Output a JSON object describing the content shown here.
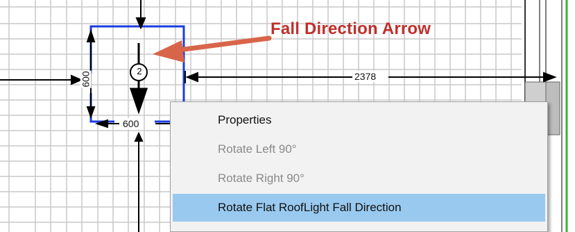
{
  "callout": {
    "text": "Fall Direction Arrow",
    "color": "#c0302c"
  },
  "drawing": {
    "rooflight_marker_label": "2",
    "dimensions": {
      "horizontal": "2378",
      "vertical": "600",
      "bottom": "600"
    },
    "colors": {
      "grid": "#c8c8c8",
      "outline": "#1a3de0",
      "green_line": "#2eb82e"
    }
  },
  "context_menu": {
    "items": [
      {
        "label": "Properties",
        "disabled": false,
        "highlighted": false
      },
      {
        "label": "Rotate Left 90°",
        "disabled": true,
        "highlighted": false
      },
      {
        "label": "Rotate Right 90°",
        "disabled": true,
        "highlighted": false
      },
      {
        "label": "Rotate Flat RoofLight Fall Direction",
        "disabled": false,
        "highlighted": true
      }
    ],
    "highlight_color": "#99c9ef"
  }
}
